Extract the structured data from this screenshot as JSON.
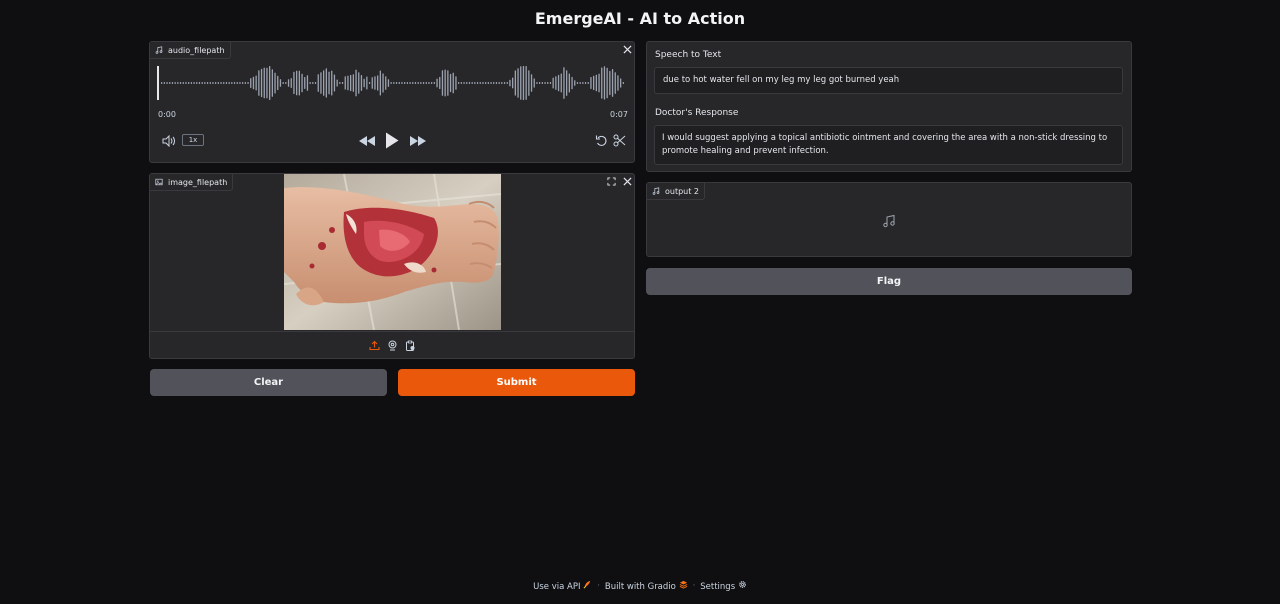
{
  "app": {
    "title": "EmergeAI - AI to Action"
  },
  "audio_input": {
    "label": "audio_filepath",
    "time_start": "0:00",
    "time_end": "0:07",
    "speed": "1x"
  },
  "image_input": {
    "label": "image_filepath"
  },
  "buttons": {
    "clear": "Clear",
    "submit": "Submit",
    "flag": "Flag"
  },
  "speech_to_text": {
    "label": "Speech to Text",
    "value": "due to hot water fell on my leg my leg got burned yeah"
  },
  "doctor_response": {
    "label": "Doctor's Response",
    "value": "I would suggest applying a topical antibiotic ointment and covering the area with a non-stick dressing to promote healing and prevent infection."
  },
  "output_audio": {
    "label": "output 2"
  },
  "footer": {
    "api": "Use via API",
    "built": "Built with Gradio",
    "settings": "Settings"
  },
  "colors": {
    "accent": "#ea580c",
    "secondary_button": "#52525b",
    "background": "#0f0f11",
    "panel": "#27272a"
  },
  "icons": [
    "music-icon",
    "close-icon",
    "volume-icon",
    "rewind-icon",
    "play-icon",
    "fast-forward-icon",
    "undo-icon",
    "scissors-icon",
    "image-icon",
    "fullscreen-icon",
    "upload-icon",
    "webcam-icon",
    "clipboard-icon",
    "rocket-icon",
    "gradio-logo-icon",
    "gear-icon"
  ]
}
